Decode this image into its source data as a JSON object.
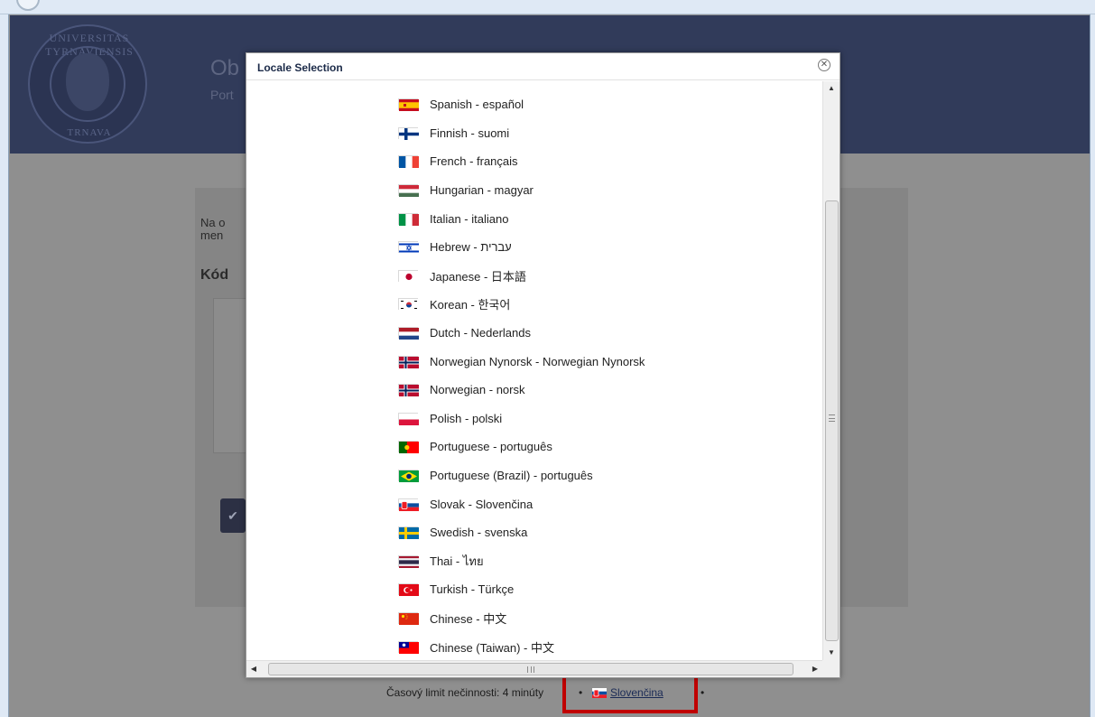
{
  "header": {
    "title": "Ob",
    "subtitle": "Port",
    "seal_top_text": "UNIVERSITAS TYRNAVIENSIS",
    "seal_bottom_text": "TRNAVA"
  },
  "content": {
    "text_line1": "Na o",
    "text_line2": "men",
    "label": "Kód",
    "button_icon": "check-icon"
  },
  "footer": {
    "timeout_text": "Časový limit nečinnosti: 4 minúty",
    "dot": "•",
    "current_language": "Slovenčina",
    "current_flag": "flag-sk"
  },
  "dialog": {
    "title": "Locale Selection",
    "close_icon": "close-circle-icon",
    "locales": [
      {
        "label": "Spanish - español",
        "flag": "es"
      },
      {
        "label": "Finnish - suomi",
        "flag": "fi"
      },
      {
        "label": "French - français",
        "flag": "fr"
      },
      {
        "label": "Hungarian - magyar",
        "flag": "hu"
      },
      {
        "label": "Italian - italiano",
        "flag": "it"
      },
      {
        "label": "Hebrew - עברית",
        "flag": "il"
      },
      {
        "label": "Japanese - 日本語",
        "flag": "jp"
      },
      {
        "label": "Korean - 한국어",
        "flag": "kr"
      },
      {
        "label": "Dutch - Nederlands",
        "flag": "nl"
      },
      {
        "label": "Norwegian Nynorsk - Norwegian Nynorsk",
        "flag": "no"
      },
      {
        "label": "Norwegian - norsk",
        "flag": "no"
      },
      {
        "label": "Polish - polski",
        "flag": "pl"
      },
      {
        "label": "Portuguese - português",
        "flag": "pt"
      },
      {
        "label": "Portuguese (Brazil) - português",
        "flag": "br"
      },
      {
        "label": "Slovak - Slovenčina",
        "flag": "sk"
      },
      {
        "label": "Swedish - svenska",
        "flag": "se"
      },
      {
        "label": "Thai - ไทย",
        "flag": "th"
      },
      {
        "label": "Turkish - Türkçe",
        "flag": "tr"
      },
      {
        "label": "Chinese - 中文",
        "flag": "cn"
      },
      {
        "label": "Chinese (Taiwan) - 中文",
        "flag": "tw"
      }
    ]
  },
  "colors": {
    "header_bg": "#313b5a",
    "highlight_border": "#c00000",
    "dialog_title": "#1b2a48"
  }
}
